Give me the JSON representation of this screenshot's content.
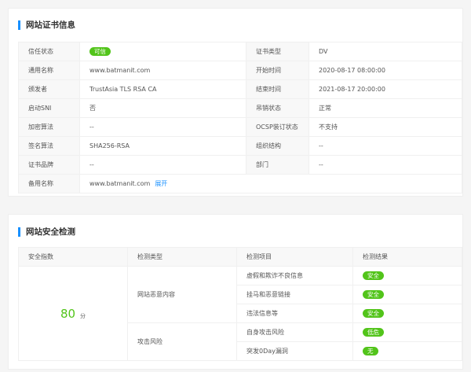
{
  "cert": {
    "title": "网站证书信息",
    "rows": [
      {
        "l1": "信任状态",
        "v1": "可信",
        "l2": "证书类型",
        "v2": "DV"
      },
      {
        "l1": "通用名称",
        "v1": "www.batmanit.com",
        "l2": "开始时间",
        "v2": "2020-08-17 08:00:00"
      },
      {
        "l1": "颁发者",
        "v1": "TrustAsia TLS RSA CA",
        "l2": "结束时间",
        "v2": "2021-08-17 20:00:00"
      },
      {
        "l1": "启动SNI",
        "v1": "否",
        "l2": "吊销状态",
        "v2": "正常"
      },
      {
        "l1": "加密算法",
        "v1": "--",
        "l2": "OCSP装订状态",
        "v2": "不支持"
      },
      {
        "l1": "签名算法",
        "v1": "SHA256-RSA",
        "l2": "组织结构",
        "v2": "--"
      },
      {
        "l1": "证书品牌",
        "v1": "--",
        "l2": "部门",
        "v2": "--"
      }
    ],
    "alt_label": "备用名称",
    "alt_value": "www.batmanit.com",
    "expand": "展开"
  },
  "security": {
    "title": "网站安全检测",
    "headers": [
      "安全指数",
      "检测类型",
      "检测项目",
      "检测结果"
    ],
    "score": "80",
    "score_unit": "分",
    "groups": [
      {
        "type": "网站恶意内容"
      },
      {
        "type": "攻击风险"
      }
    ],
    "items": [
      {
        "name": "虚假和欺诈不良信息",
        "result": "安全"
      },
      {
        "name": "挂马和恶意链接",
        "result": "安全"
      },
      {
        "name": "违法信息等",
        "result": "安全"
      },
      {
        "name": "自身攻击风险",
        "result": "低危"
      },
      {
        "name": "突发0Day漏洞",
        "result": "无"
      }
    ]
  },
  "colors": {
    "accent": "#1890ff",
    "success": "#52c41a"
  }
}
